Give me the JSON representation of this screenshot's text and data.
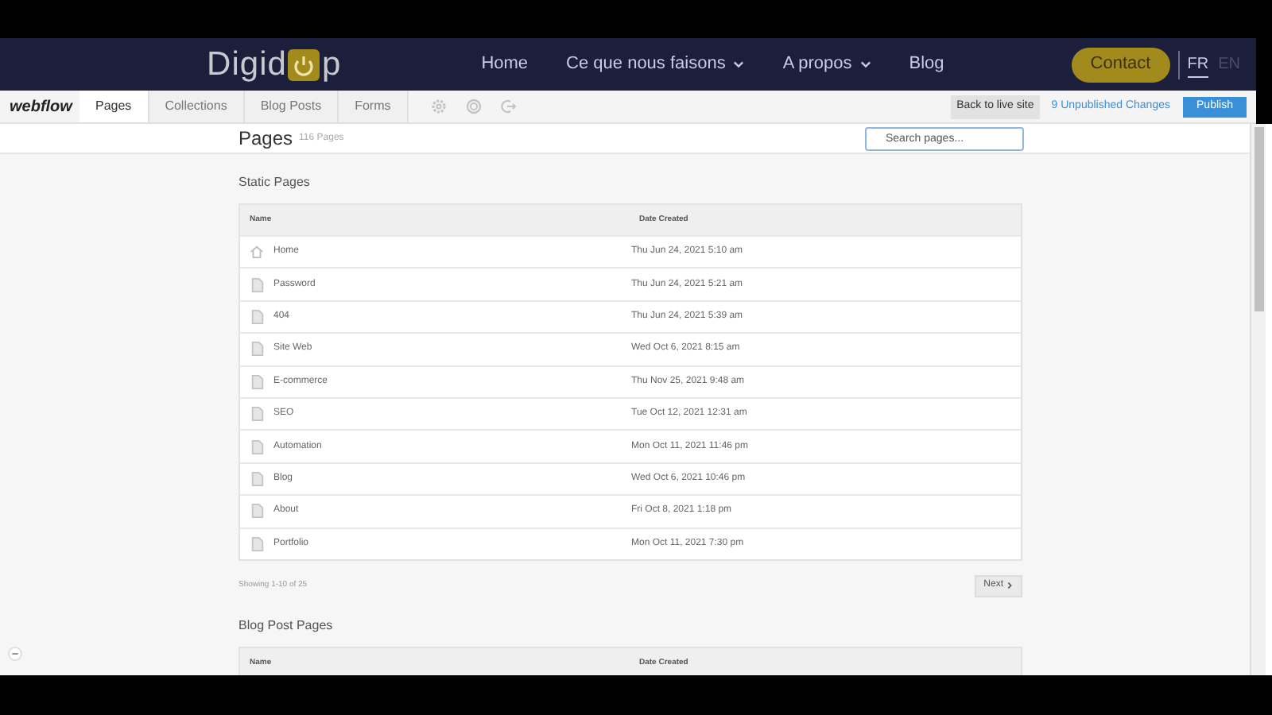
{
  "site_nav": {
    "logo_before": "Digid",
    "logo_after": "p",
    "links": [
      {
        "label": "Home",
        "dropdown": false
      },
      {
        "label": "Ce que nous faisons",
        "dropdown": true
      },
      {
        "label": "A propos",
        "dropdown": true
      },
      {
        "label": "Blog",
        "dropdown": false
      }
    ],
    "contact": "Contact",
    "languages": [
      {
        "label": "FR",
        "selected": true
      },
      {
        "label": "EN",
        "selected": false
      }
    ]
  },
  "editor_bar": {
    "brand": "webflow",
    "tabs": [
      {
        "label": "Pages",
        "selected": true
      },
      {
        "label": "Collections",
        "selected": false
      },
      {
        "label": "Blog Posts",
        "selected": false
      },
      {
        "label": "Forms",
        "selected": false
      }
    ],
    "back_button": "Back to live site",
    "changes_link": "9 Unpublished Changes",
    "publish_button": "Publish"
  },
  "header": {
    "title": "Pages",
    "count": "116 Pages",
    "search_placeholder": "Search pages..."
  },
  "static_pages": {
    "title": "Static Pages",
    "columns": [
      "Name",
      "Date Created"
    ],
    "rows": [
      {
        "kind": "home",
        "name": "Home",
        "date": "Thu Jun 24, 2021 5:10 am"
      },
      {
        "kind": "page",
        "name": "Password",
        "date": "Thu Jun 24, 2021 5:21 am"
      },
      {
        "kind": "page",
        "name": "404",
        "date": "Thu Jun 24, 2021 5:39 am"
      },
      {
        "kind": "page",
        "name": "Site Web",
        "date": "Wed Oct 6, 2021 8:15 am"
      },
      {
        "kind": "page",
        "name": "E-commerce",
        "date": "Thu Nov 25, 2021 9:48 am"
      },
      {
        "kind": "page",
        "name": "SEO",
        "date": "Tue Oct 12, 2021 12:31 am"
      },
      {
        "kind": "page",
        "name": "Automation",
        "date": "Mon Oct 11, 2021 11:46 pm"
      },
      {
        "kind": "page",
        "name": "Blog",
        "date": "Wed Oct 6, 2021 10:46 pm"
      },
      {
        "kind": "page",
        "name": "About",
        "date": "Fri Oct 8, 2021 1:18 pm"
      },
      {
        "kind": "page",
        "name": "Portfolio",
        "date": "Mon Oct 11, 2021 7:30 pm"
      }
    ],
    "showing": "Showing 1-10 of 25",
    "next_button": "Next"
  },
  "blog_post_pages": {
    "title": "Blog Post Pages",
    "columns": [
      "Name",
      "Date Created"
    ]
  }
}
